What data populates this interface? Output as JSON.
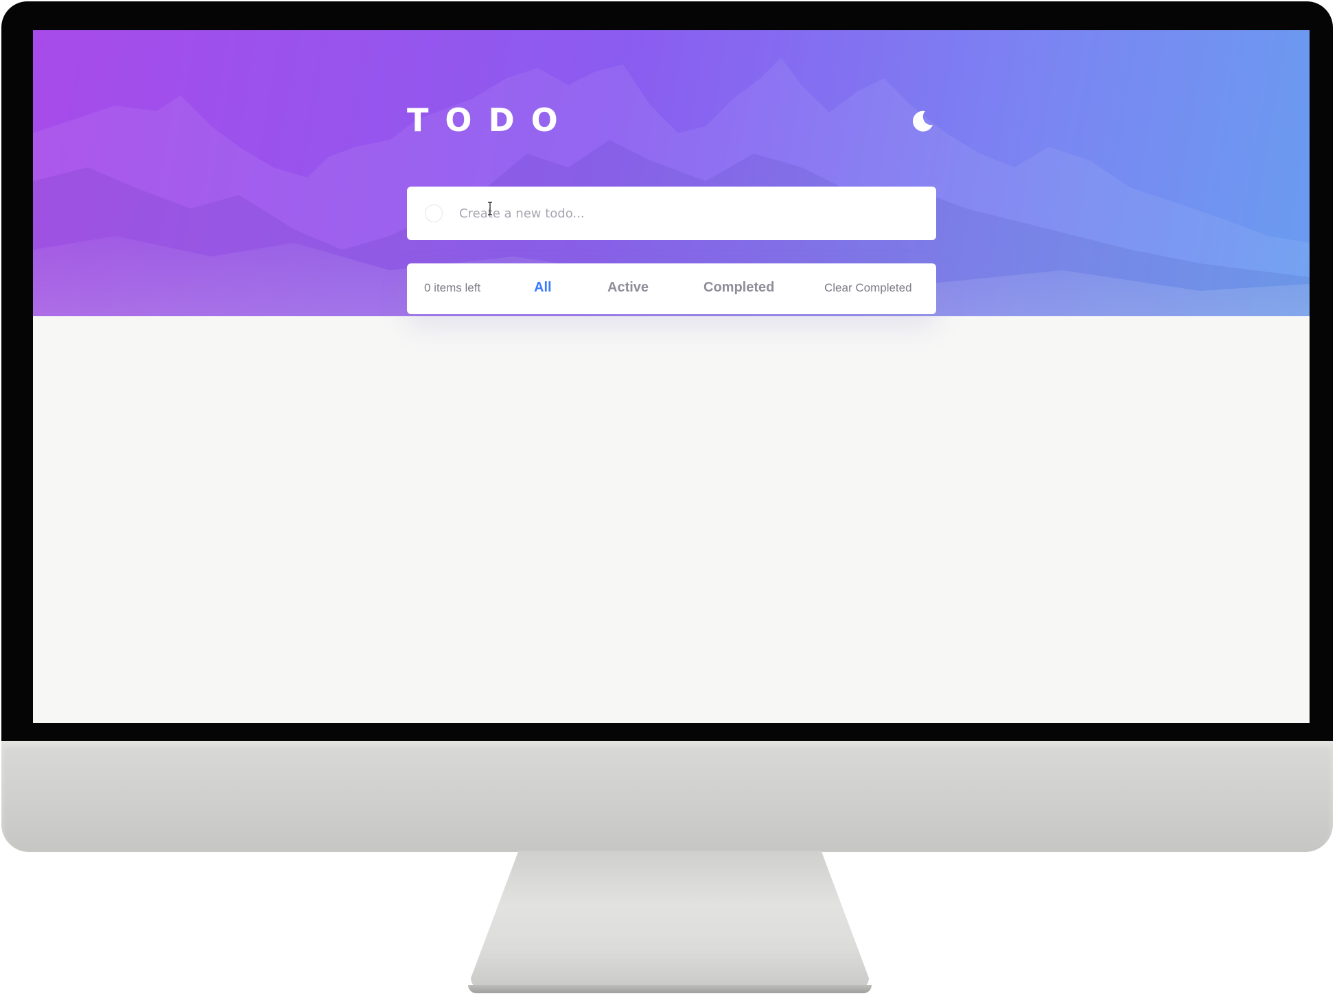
{
  "app": {
    "title": "TODO",
    "theme_toggle_icon": "moon-icon"
  },
  "new_todo": {
    "placeholder": "Create a new todo...",
    "value": ""
  },
  "footer": {
    "items_left": "0 items left",
    "filters": [
      {
        "label": "All",
        "selected": true
      },
      {
        "label": "Active",
        "selected": false
      },
      {
        "label": "Completed",
        "selected": false
      }
    ],
    "clear_completed": "Clear Completed"
  },
  "colors": {
    "accent": "#3a7bfd",
    "hero_gradient_start": "#a74bea",
    "hero_gradient_end": "#6a9cf0",
    "page_background": "#f7f7f6"
  }
}
